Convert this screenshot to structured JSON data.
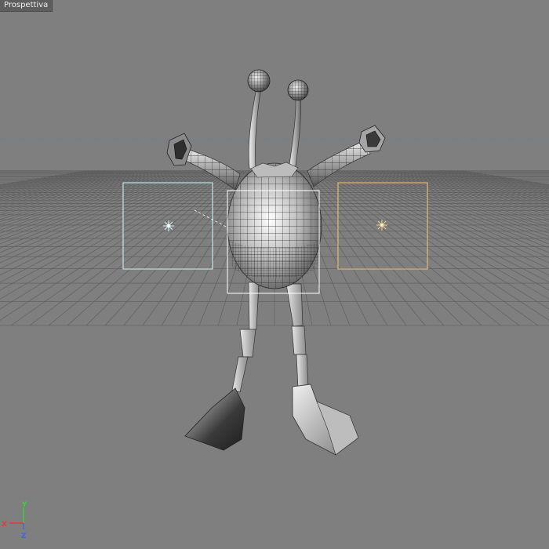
{
  "viewport": {
    "label": "Prospettiva",
    "background_color": "#7f7f7f"
  },
  "scene": {
    "object": "wireframe-character",
    "lights": [
      {
        "name": "left-light",
        "color": "#bfe8e4"
      },
      {
        "name": "right-light",
        "color": "#e6b67a"
      }
    ]
  },
  "axis_gizmo": {
    "x_label": "X",
    "y_label": "Y",
    "z_label": "Z",
    "x_color": "#e03a3a",
    "y_color": "#3ad13a",
    "z_color": "#3a6ae0"
  }
}
